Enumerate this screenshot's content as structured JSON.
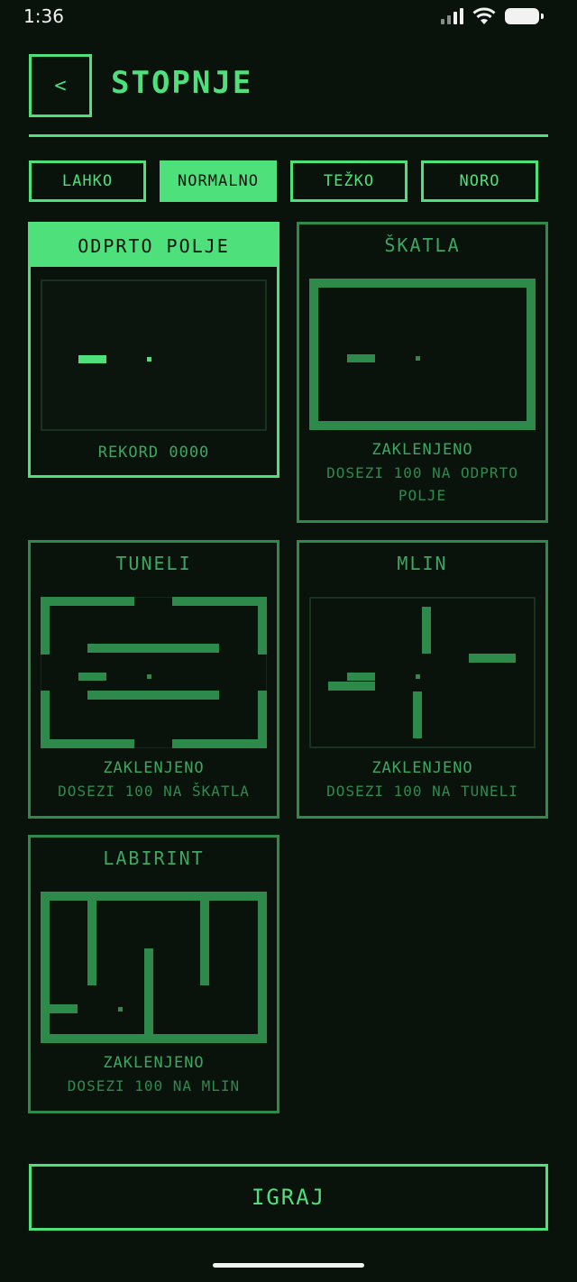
{
  "status_bar": {
    "time": "1:36"
  },
  "header": {
    "back_label": "<",
    "title": "STOPNJE"
  },
  "difficulty_tabs": [
    {
      "label": "LAHKO",
      "active": false
    },
    {
      "label": "NORMALNO",
      "active": true
    },
    {
      "label": "TEŽKO",
      "active": false
    },
    {
      "label": "NORO",
      "active": false
    }
  ],
  "levels": [
    {
      "name": "ODPRTO POLJE",
      "status": "REKORD 0000",
      "selected": true
    },
    {
      "name": "ŠKATLA",
      "status": "ZAKLENJENO",
      "requirement": "DOSEZI 100 NA ODPRTO POLJE"
    },
    {
      "name": "TUNELI",
      "status": "ZAKLENJENO",
      "requirement": "DOSEZI 100 NA ŠKATLA"
    },
    {
      "name": "MLIN",
      "status": "ZAKLENJENO",
      "requirement": "DOSEZI 100 NA TUNELI"
    },
    {
      "name": "LABIRINT",
      "status": "ZAKLENJENO",
      "requirement": "DOSEZI 100 NA MLIN"
    }
  ],
  "play_button": {
    "label": "IGRAJ"
  },
  "colors": {
    "accent": "#4ee07a",
    "locked": "#2d8a4a",
    "background": "#09120b"
  },
  "icons": {
    "back": "chevron-left-icon",
    "signal": "signal-icon",
    "wifi": "wifi-icon",
    "battery": "battery-icon"
  }
}
